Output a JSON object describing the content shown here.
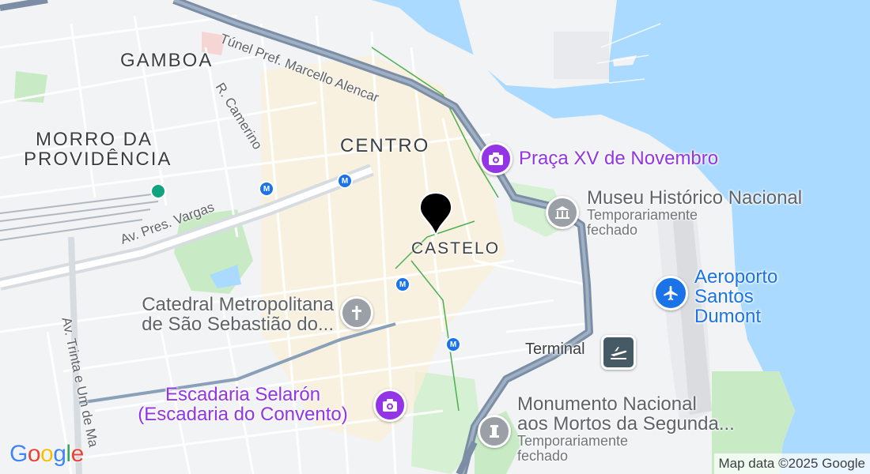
{
  "map": {
    "districts": [
      "GAMBOA",
      "MORRO DA",
      "PROVIDÊNCIA",
      "CENTRO",
      "CASTELO"
    ],
    "streets": [
      "Túnel Pref. Marcello Alencar",
      "R. Camerino",
      "Av. Pres. Vargas",
      "Av. Trinta e Um de Ma"
    ],
    "pois": {
      "praca": {
        "name": "Praça XV de Novembro",
        "icon": "camera-icon"
      },
      "museu": {
        "name": "Museu Histórico Nacional",
        "status_line1": "Temporariamente",
        "status_line2": "fechado",
        "icon": "museum-icon"
      },
      "aeroporto": {
        "line1": "Aeroporto",
        "line2": "Santos",
        "line3": "Dumont",
        "icon": "airplane-icon"
      },
      "catedral": {
        "line1": "Catedral Metropolitana",
        "line2": "de São Sebastião do...",
        "icon": "church-icon"
      },
      "terminal": {
        "name": "Terminal",
        "icon": "airport-terminal-icon"
      },
      "selaron": {
        "line1": "Escadaria Selarón",
        "line2": "(Escadaria do Convento)",
        "icon": "camera-icon"
      },
      "monumento": {
        "line1": "Monumento Nacional",
        "line2": "aos Mortos da Segunda...",
        "status_line1": "Temporariamente",
        "status_line2": "fechado",
        "icon": "monument-icon"
      }
    },
    "metro_glyph": "M",
    "marker_icon": "location-pin-icon",
    "logo": [
      "G",
      "o",
      "o",
      "g",
      "l",
      "e"
    ],
    "attribution": "Map data ©2025 Google"
  },
  "colors": {
    "water": "#aadaff",
    "land": "#f1f3f4",
    "park": "#c8ebc6",
    "highway": "#7c8ea6",
    "poi_purple": "#9334e6",
    "poi_gray": "#70757a",
    "poi_blue": "#1a73e8",
    "logo": [
      "#4285f4",
      "#ea4335",
      "#fbbc05",
      "#4285f4",
      "#34a853",
      "#ea4335"
    ]
  }
}
